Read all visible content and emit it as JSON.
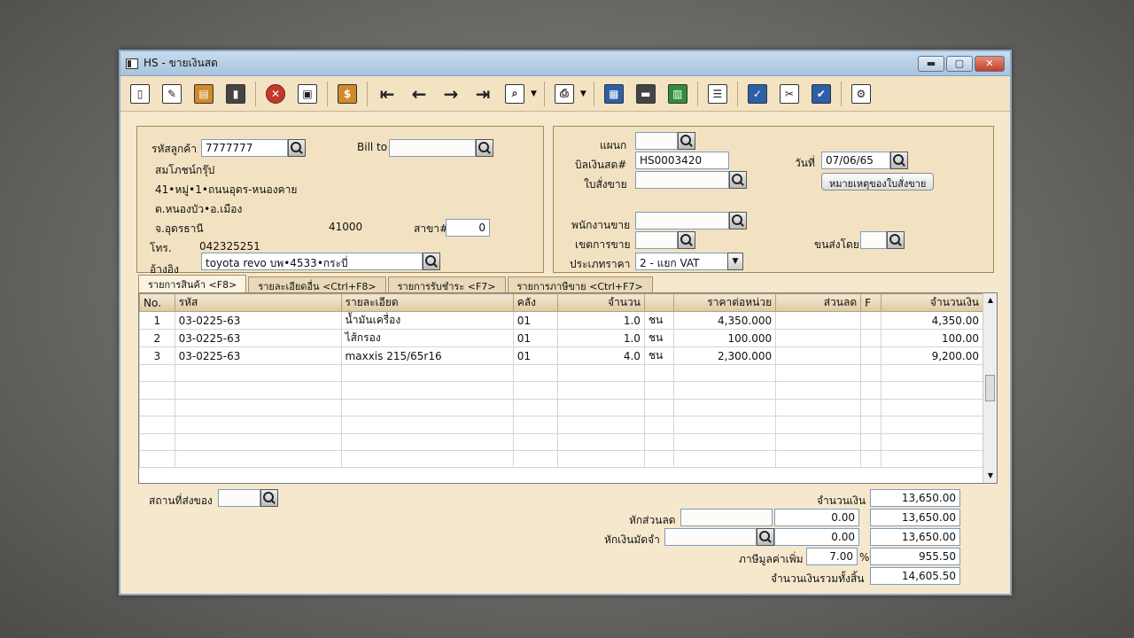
{
  "window": {
    "title": "HS - ขายเงินสด",
    "controls": {
      "minimize": "▬",
      "maximize": "▢",
      "close": "✕"
    }
  },
  "toolbar": {
    "icons": [
      "new-doc-icon",
      "edit-icon",
      "attach-icon",
      "delete-icon",
      "cancel-icon",
      "save-icon",
      "money-icon",
      "first-record-icon",
      "prev-record-icon",
      "next-record-icon",
      "last-record-icon",
      "find-icon",
      "print-icon",
      "export-icon",
      "card-icon",
      "calc-icon",
      "report-icon",
      "approve-icon",
      "tools-icon",
      "ok-icon",
      "config-icon"
    ]
  },
  "customer": {
    "code_label": "รหัสลูกค้า",
    "code_value": "7777777",
    "name": "สมโภชน์กรุ๊ป",
    "addr1": "41•หมู่•1•ถนนอุดร-หนองคาย",
    "addr2": "ต.หนองบัว•อ.เมือง",
    "addr3": "จ.อุดรธานี",
    "zip": "41000",
    "billto_label": "Bill to",
    "billto_value": "",
    "branch_label": "สาขา#",
    "branch_value": "0",
    "phone_label": "โทร.",
    "phone_value": "042325251",
    "ref_label": "อ้างอิง",
    "ref_value": "toyota revo บพ•4533•กระบี่"
  },
  "doc": {
    "dept_label": "แผนก",
    "dept_value": "",
    "bill_label": "บิลเงินสด#",
    "bill_value": "HS0003420",
    "date_label": "วันที่",
    "date_value": "07/06/65",
    "so_label": "ใบสั่งขาย",
    "so_value": "",
    "so_note_button": "หมายเหตุของใบสั่งขาย",
    "salesperson_label": "พนักงานขาย",
    "salesperson_value": "",
    "terms_label": "เขตการขาย",
    "terms_value": "",
    "ship_label": "ขนส่งโดย",
    "ship_value": "",
    "price_type_label": "ประเภทราคา",
    "price_type_value": "2 - แยก VAT"
  },
  "tabs": [
    "รายการสินค้า <F8>",
    "รายละเอียดอื่น <Ctrl+F8>",
    "รายการรับชำระ <F7>",
    "รายการภาษีขาย <Ctrl+F7>"
  ],
  "grid": {
    "headers": [
      "No.",
      "รหัส",
      "รายละเอียด",
      "คลัง",
      "จำนวน",
      "",
      "ราคาต่อหน่วย",
      "ส่วนลด",
      "F",
      "จำนวนเงิน"
    ],
    "rows": [
      [
        "1",
        "03-0225-63",
        "น้ำมันเครื่อง",
        "01",
        "1.0",
        "ชน",
        "4,350.000",
        "",
        "",
        "4,350.00"
      ],
      [
        "2",
        "03-0225-63",
        "ไส้กรอง",
        "01",
        "1.0",
        "ชน",
        "100.000",
        "",
        "",
        "100.00"
      ],
      [
        "3",
        "03-0225-63",
        "maxxis 215/65r16",
        "01",
        "4.0",
        "ชน",
        "2,300.000",
        "",
        "",
        "9,200.00"
      ]
    ]
  },
  "footer": {
    "ship_place_label": "สถานที่ส่งของ",
    "ship_place_value": "",
    "amount_label": "จำนวนเงิน",
    "amount_value": "13,650.00",
    "discount_label": "หักส่วนลด",
    "discount_input": "",
    "discount_value": "0.00",
    "discount_total": "13,650.00",
    "deposit_label": "หักเงินมัดจำ",
    "deposit_input": "",
    "deposit_value": "0.00",
    "deposit_total": "13,650.00",
    "vat_label": "ภาษีมูลค่าเพิ่ม",
    "vat_rate": "7.00",
    "vat_pct": "%",
    "vat_value": "955.50",
    "grand_label": "จำนวนเงินรวมทั้งสิ้น",
    "grand_value": "14,605.50"
  }
}
